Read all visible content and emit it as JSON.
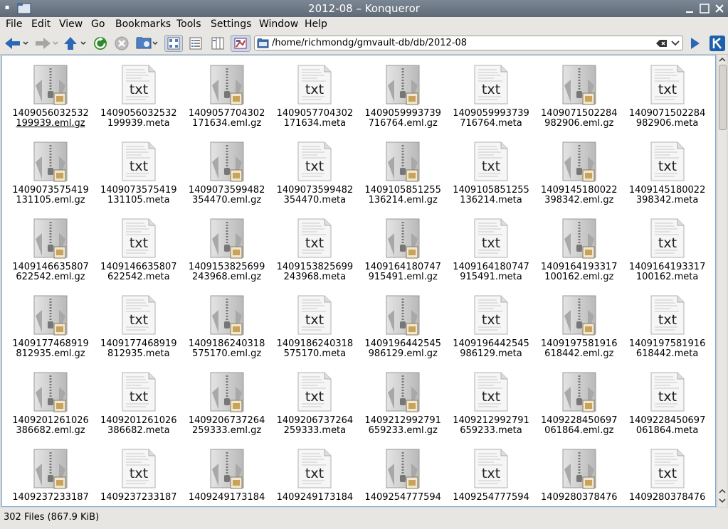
{
  "window": {
    "title": "2012-08 – Konqueror"
  },
  "menu": [
    "File",
    "Edit",
    "View",
    "Go",
    "Bookmarks",
    "Tools",
    "Settings",
    "Window",
    "Help"
  ],
  "location": {
    "path": "/home/richmondg/gmvault-db/db/2012-08"
  },
  "files": [
    {
      "line1": "1409056032532",
      "line2": "199939.eml.gz",
      "type": "gz"
    },
    {
      "line1": "1409056032532",
      "line2": "199939.meta",
      "type": "txt"
    },
    {
      "line1": "1409057704302",
      "line2": "171634.eml.gz",
      "type": "gz"
    },
    {
      "line1": "1409057704302",
      "line2": "171634.meta",
      "type": "txt"
    },
    {
      "line1": "1409059993739",
      "line2": "716764.eml.gz",
      "type": "gz"
    },
    {
      "line1": "1409059993739",
      "line2": "716764.meta",
      "type": "txt"
    },
    {
      "line1": "1409071502284",
      "line2": "982906.eml.gz",
      "type": "gz"
    },
    {
      "line1": "1409071502284",
      "line2": "982906.meta",
      "type": "txt"
    },
    {
      "line1": "1409073575419",
      "line2": "131105.eml.gz",
      "type": "gz"
    },
    {
      "line1": "1409073575419",
      "line2": "131105.meta",
      "type": "txt"
    },
    {
      "line1": "1409073599482",
      "line2": "354470.eml.gz",
      "type": "gz"
    },
    {
      "line1": "1409073599482",
      "line2": "354470.meta",
      "type": "txt"
    },
    {
      "line1": "1409105851255",
      "line2": "136214.eml.gz",
      "type": "gz"
    },
    {
      "line1": "1409105851255",
      "line2": "136214.meta",
      "type": "txt"
    },
    {
      "line1": "1409145180022",
      "line2": "398342.eml.gz",
      "type": "gz"
    },
    {
      "line1": "1409145180022",
      "line2": "398342.meta",
      "type": "txt"
    },
    {
      "line1": "1409146635807",
      "line2": "622542.eml.gz",
      "type": "gz"
    },
    {
      "line1": "1409146635807",
      "line2": "622542.meta",
      "type": "txt"
    },
    {
      "line1": "1409153825699",
      "line2": "243968.eml.gz",
      "type": "gz"
    },
    {
      "line1": "1409153825699",
      "line2": "243968.meta",
      "type": "txt"
    },
    {
      "line1": "1409164180747",
      "line2": "915491.eml.gz",
      "type": "gz"
    },
    {
      "line1": "1409164180747",
      "line2": "915491.meta",
      "type": "txt"
    },
    {
      "line1": "1409164193317",
      "line2": "100162.eml.gz",
      "type": "gz"
    },
    {
      "line1": "1409164193317",
      "line2": "100162.meta",
      "type": "txt"
    },
    {
      "line1": "1409177468919",
      "line2": "812935.eml.gz",
      "type": "gz"
    },
    {
      "line1": "1409177468919",
      "line2": "812935.meta",
      "type": "txt"
    },
    {
      "line1": "1409186240318",
      "line2": "575170.eml.gz",
      "type": "gz"
    },
    {
      "line1": "1409186240318",
      "line2": "575170.meta",
      "type": "txt"
    },
    {
      "line1": "1409196442545",
      "line2": "986129.eml.gz",
      "type": "gz"
    },
    {
      "line1": "1409196442545",
      "line2": "986129.meta",
      "type": "txt"
    },
    {
      "line1": "1409197581916",
      "line2": "618442.eml.gz",
      "type": "gz"
    },
    {
      "line1": "1409197581916",
      "line2": "618442.meta",
      "type": "txt"
    },
    {
      "line1": "1409201261026",
      "line2": "386682.eml.gz",
      "type": "gz"
    },
    {
      "line1": "1409201261026",
      "line2": "386682.meta",
      "type": "txt"
    },
    {
      "line1": "1409206737264",
      "line2": "259333.eml.gz",
      "type": "gz"
    },
    {
      "line1": "1409206737264",
      "line2": "259333.meta",
      "type": "txt"
    },
    {
      "line1": "1409212992791",
      "line2": "659233.eml.gz",
      "type": "gz"
    },
    {
      "line1": "1409212992791",
      "line2": "659233.meta",
      "type": "txt"
    },
    {
      "line1": "1409228450697",
      "line2": "061864.eml.gz",
      "type": "gz"
    },
    {
      "line1": "1409228450697",
      "line2": "061864.meta",
      "type": "txt"
    },
    {
      "line1": "1409237233187",
      "line2": "",
      "type": "gz"
    },
    {
      "line1": "1409237233187",
      "line2": "",
      "type": "txt"
    },
    {
      "line1": "1409249173184",
      "line2": "",
      "type": "gz"
    },
    {
      "line1": "1409249173184",
      "line2": "",
      "type": "txt"
    },
    {
      "line1": "1409254777594",
      "line2": "",
      "type": "gz"
    },
    {
      "line1": "1409254777594",
      "line2": "",
      "type": "txt"
    },
    {
      "line1": "1409280378476",
      "line2": "",
      "type": "gz"
    },
    {
      "line1": "1409280378476",
      "line2": "",
      "type": "txt"
    }
  ],
  "txt_icon_text": "txt",
  "status": {
    "text": "302 Files (867.9 KiB)"
  }
}
